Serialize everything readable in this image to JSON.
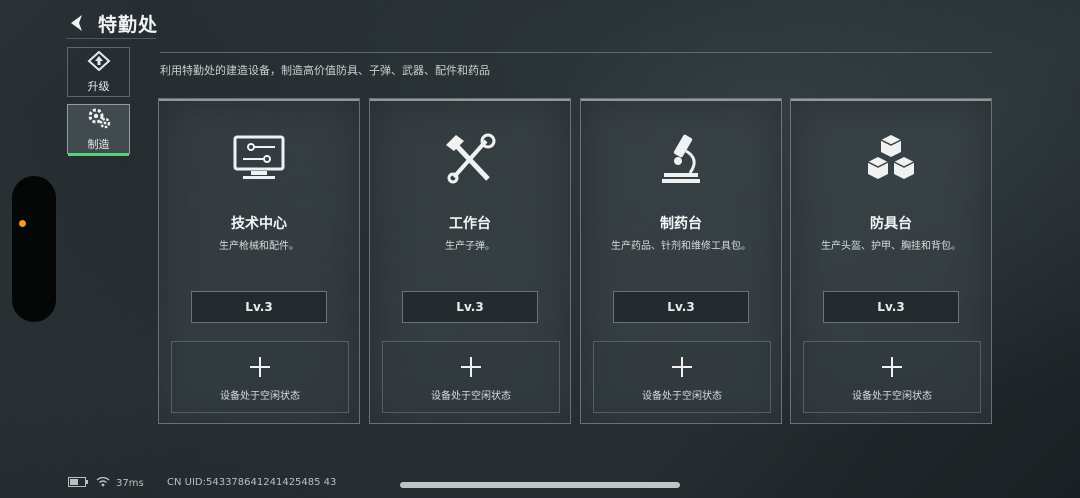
{
  "header": {
    "title": "特勤处",
    "subtitle": "利用特勤处的建造设备，制造高价值防具、子弹、武器、配件和药品"
  },
  "sidebar": {
    "tabs": [
      {
        "label": "升级",
        "icon": "upgrade-icon",
        "active": false
      },
      {
        "label": "制造",
        "icon": "gears-icon",
        "active": true
      }
    ]
  },
  "stations": [
    {
      "name": "技术中心",
      "desc": "生产枪械和配件。",
      "level": "Lv.3",
      "slot_status": "设备处于空闲状态",
      "icon": "monitor-icon"
    },
    {
      "name": "工作台",
      "desc": "生产子弹。",
      "level": "Lv.3",
      "slot_status": "设备处于空闲状态",
      "icon": "hammer-wrench-icon"
    },
    {
      "name": "制药台",
      "desc": "生产药品、针剂和维修工具包。",
      "level": "Lv.3",
      "slot_status": "设备处于空闲状态",
      "icon": "microscope-icon"
    },
    {
      "name": "防具台",
      "desc": "生产头盔、护甲、胸挂和背包。",
      "level": "Lv.3",
      "slot_status": "设备处于空闲状态",
      "icon": "boxes-icon"
    }
  ],
  "status_bar": {
    "ping": "37ms",
    "uid": "CN UID:543378641241425485 43"
  },
  "colors": {
    "active_tab_accent": "#57d07a",
    "notice_dot": "#f29a26"
  }
}
